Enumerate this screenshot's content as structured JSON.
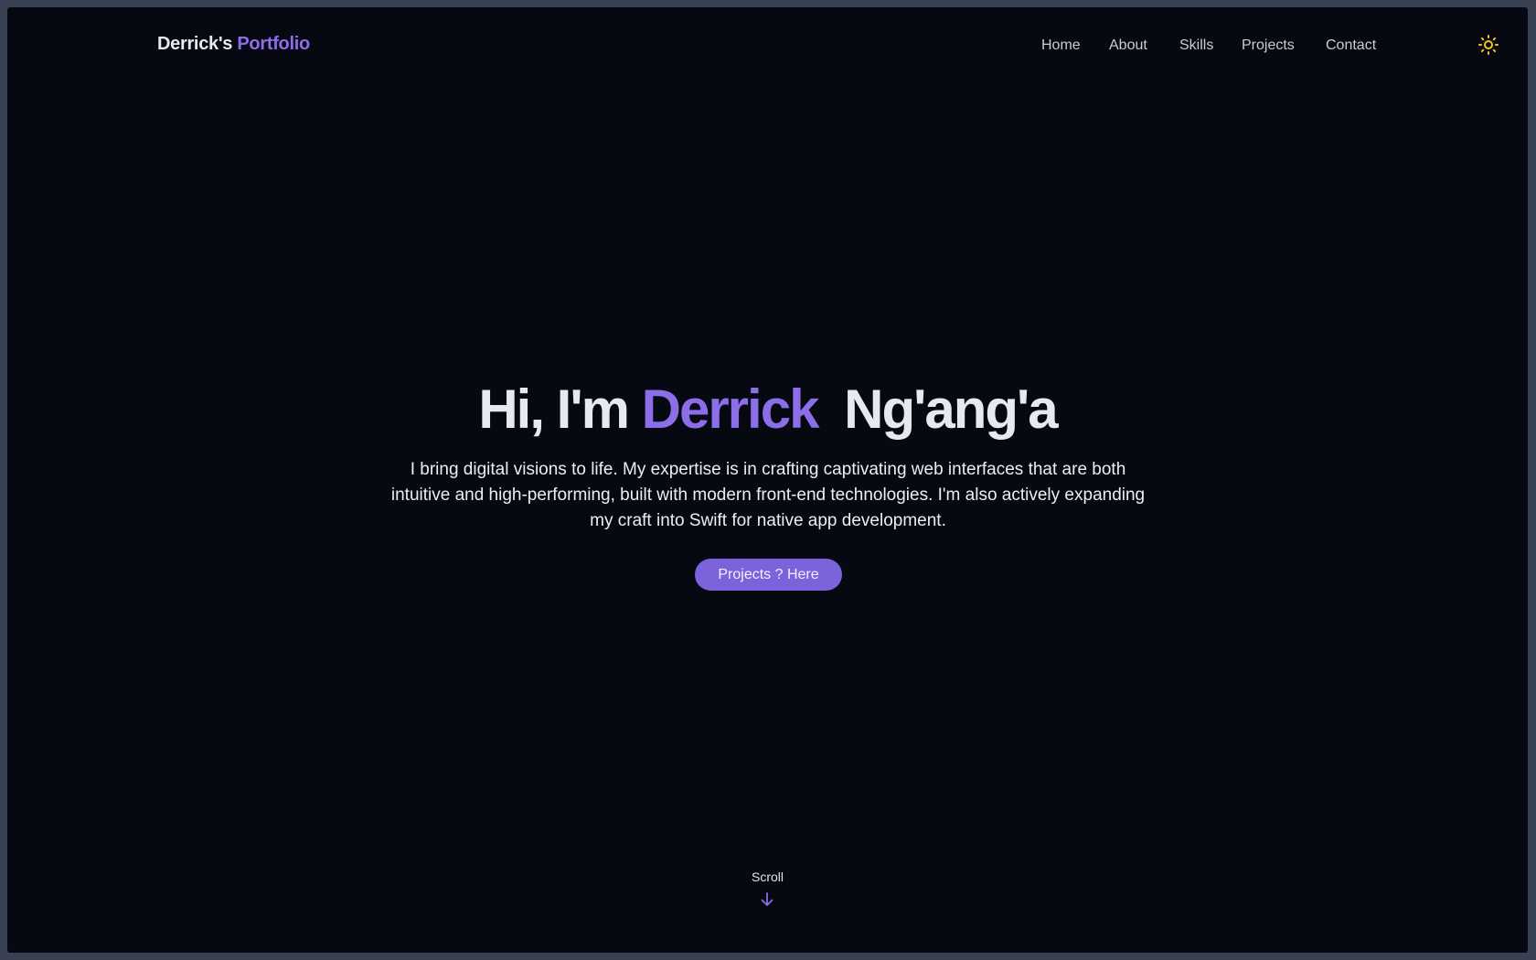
{
  "header": {
    "brand_name": "Derrick's",
    "brand_accent": "Portfolio",
    "nav": [
      {
        "label": "Home"
      },
      {
        "label": "About"
      },
      {
        "label": "Skills"
      },
      {
        "label": "Projects"
      },
      {
        "label": "Contact"
      }
    ],
    "theme_toggle_icon": "sun-icon"
  },
  "hero": {
    "greeting": "Hi, I'm",
    "first_name": "Derrick",
    "last_name": "Ng'ang'a",
    "description": "I bring digital visions to life. My expertise is in crafting captivating web interfaces that are both intuitive and high-performing, built with modern front-end technologies. I'm also actively expanding my craft into Swift for native app development.",
    "cta_label": "Projects ? Here"
  },
  "scroll": {
    "label": "Scroll",
    "icon": "arrow-down-icon"
  },
  "colors": {
    "background": "#060912",
    "accent": "#8b6ee8",
    "button": "#7b63dc",
    "sun": "#f5c518"
  }
}
